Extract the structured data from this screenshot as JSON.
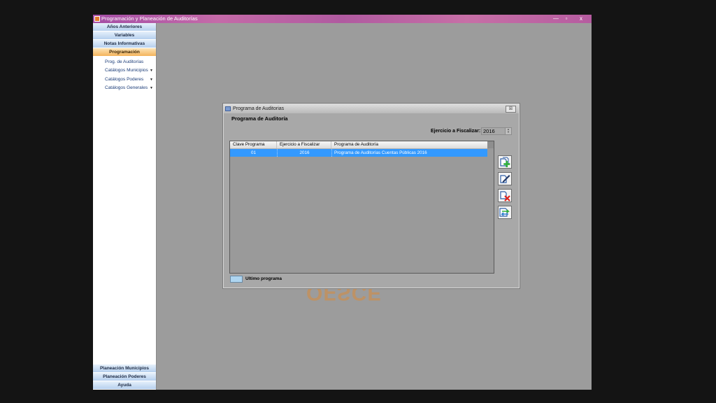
{
  "window": {
    "title": "Programación y Planeación de Auditorías",
    "minimize": "—",
    "restore": "▫",
    "close": "x"
  },
  "sidebar": {
    "sections_top": [
      {
        "label": "Años Anteriores"
      },
      {
        "label": "Variables"
      },
      {
        "label": "Notas Informativas"
      },
      {
        "label": "Programación",
        "active": true
      }
    ],
    "items": [
      {
        "label": "Prog. de Auditorías",
        "has_arrow": false
      },
      {
        "label": "Catálogos Municipios",
        "has_arrow": true
      },
      {
        "label": "Catálogos Poderes",
        "has_arrow": true
      },
      {
        "label": "Catálogos Generales",
        "has_arrow": true
      }
    ],
    "arrow_glyph": "▼",
    "sections_bottom": [
      {
        "label": "Planeación Municipios"
      },
      {
        "label": "Planeación Poderes"
      },
      {
        "label": "Ayuda"
      }
    ]
  },
  "watermark": {
    "text": "OFSCE",
    "color": "#d88a3a"
  },
  "dialog": {
    "title": "Programa de Auditorias",
    "close_glyph": "☒",
    "heading": "Programa de Auditoría",
    "ejercicio_label": "Ejercicio a Fiscalizar:",
    "ejercicio_value": "2016",
    "spin_up": "▲",
    "spin_down": "▼",
    "grid": {
      "columns": [
        "Clave Programa",
        "Ejercicio a Fiscalizar",
        "Programa de Auditoría"
      ],
      "rows": [
        [
          "01",
          "2016",
          "Programa de Auditorías Cuentas Públicas 2016"
        ]
      ],
      "selected_row_color": "#3399ff"
    },
    "toolbar_icons": [
      "add-document-icon",
      "edit-document-icon",
      "delete-document-icon",
      "refresh-document-icon"
    ],
    "legend": {
      "label": "Ultimo programa",
      "color": "#aed5f0"
    }
  }
}
